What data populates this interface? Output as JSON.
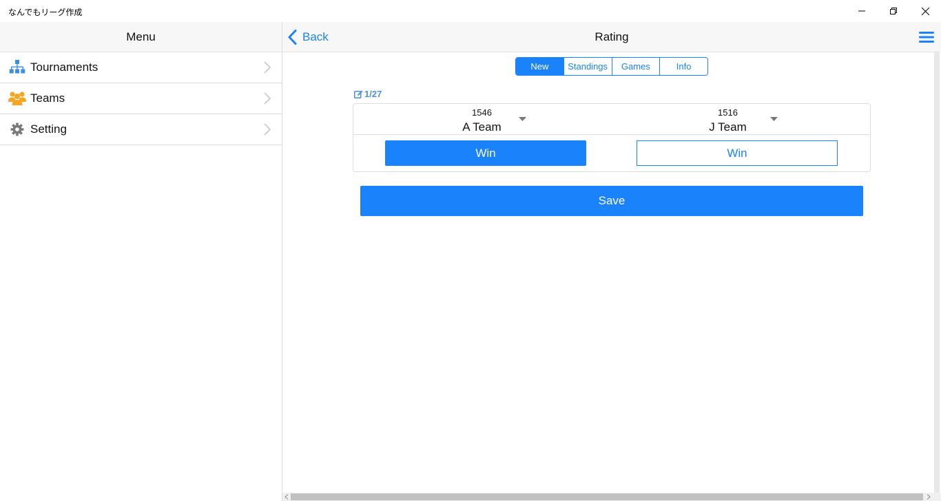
{
  "window": {
    "title": "なんでもリーグ作成",
    "controls": [
      "minimize-icon",
      "restore-icon",
      "close-icon"
    ]
  },
  "sidebar": {
    "header": "Menu",
    "items": [
      {
        "label": "Tournaments",
        "icon": "tournament-bracket-icon",
        "icon_color": "#3d8fe0"
      },
      {
        "label": "Teams",
        "icon": "team-users-icon",
        "icon_color": "#f5a623"
      },
      {
        "label": "Setting",
        "icon": "gear-icon",
        "icon_color": "#7a7a7a"
      }
    ]
  },
  "header": {
    "back_label": "Back",
    "title": "Rating",
    "menu_icon": "hamburger-menu-icon"
  },
  "tabs": [
    {
      "label": "New",
      "active": true
    },
    {
      "label": "Standings",
      "active": false
    },
    {
      "label": "Games",
      "active": false
    },
    {
      "label": "Info",
      "active": false
    }
  ],
  "game": {
    "counter": "1/27",
    "counter_icon": "edit-icon",
    "left_team": {
      "rating": "1546",
      "name": "A Team",
      "win_label": "Win",
      "win_selected": true
    },
    "right_team": {
      "rating": "1516",
      "name": "J Team",
      "win_label": "Win",
      "win_selected": false
    }
  },
  "save_label": "Save",
  "colors": {
    "accent": "#1a82fb",
    "header_bg": "#f7f7f7",
    "divider": "#dcdcdc"
  }
}
